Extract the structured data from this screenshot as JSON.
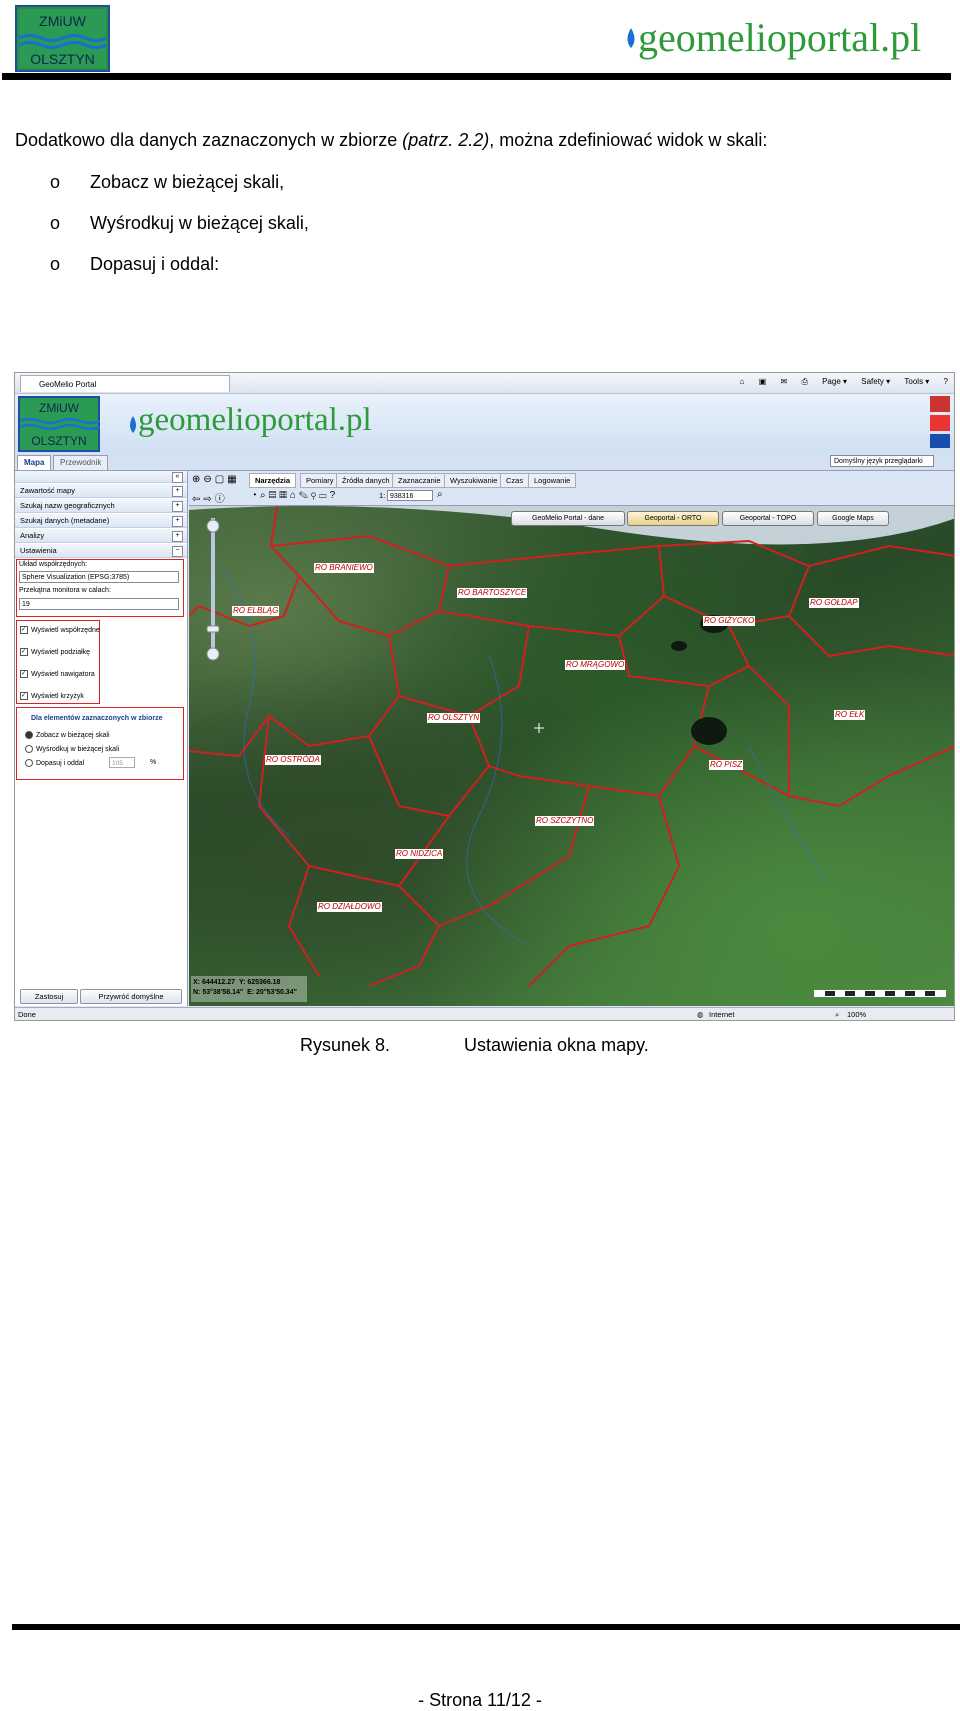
{
  "header": {
    "logo_line1": "ZMiUW",
    "logo_line2": "OLSZTYN",
    "brand": "geomelioportal.pl"
  },
  "body": {
    "intro_before": "Dodatkowo dla danych zaznaczonych w zbiorze ",
    "intro_italic": "(patrz. 2.2)",
    "intro_after": ", można zdefiniować widok w skali:",
    "bullet_marker": "o",
    "bullets": [
      "Zobacz w bieżącej skali,",
      "Wyśrodkuj w bieżącej skali,",
      "Dopasuj i oddal:"
    ]
  },
  "screenshot": {
    "browser": {
      "tab_title": "GeoMelio Portal",
      "tools": [
        "Page ▾",
        "Safety ▾",
        "Tools ▾"
      ],
      "status_done": "Done",
      "status_zone": "Internet",
      "status_zoom": "100%"
    },
    "banner": {
      "logo_line1": "ZMiUW",
      "logo_line2": "OLSZTYN",
      "brand": "geomelioportal.pl",
      "language": "Domyślny język przeglądarki"
    },
    "top_tabs": [
      "Mapa",
      "Przewodnik"
    ],
    "left_panel": {
      "sections": [
        "Zawartość mapy",
        "Szukaj nazw geograficznych",
        "Szukaj danych (metadane)",
        "Analizy",
        "Ustawienia"
      ],
      "coord_label": "Układ współrzędnych:",
      "coord_value": "Sphere Visualization (EPSG:3785)",
      "diag_label": "Przekątna monitora w calach:",
      "diag_value": "19",
      "checkboxes": [
        "Wyświetl współrzędne",
        "Wyświetl podziałkę",
        "Wyświetl nawigatora",
        "Wyświetl krzyżyk"
      ],
      "set_title": "Dla elementów zaznaczonych w zbiorze",
      "radios": [
        "Zobacz w bieżącej skali",
        "Wyśrodkuj w bieżącej skali",
        "Dopasuj i oddal"
      ],
      "zoom_value": "105",
      "zoom_unit": "%",
      "apply": "Zastosuj",
      "reset": "Przywróć domyślne"
    },
    "tool_tabs": [
      "Narzędzia",
      "Pomiary",
      "Źródła danych",
      "Zaznaczanie",
      "Wyszukiwanie",
      "Czas",
      "Logowanie"
    ],
    "scale_prefix": "1:",
    "scale_value": "938316",
    "map_buttons": [
      "GeoMelio Portal - dane",
      "Geoportal - ORTO",
      "Geoportal - TOPO",
      "Google Maps"
    ],
    "regions": [
      "RO BRANIEWO",
      "RO BARTOSZYCE",
      "RO ELBLĄG",
      "RO GIŻYCKO",
      "RO GOŁDAP",
      "RO MRĄGOWO",
      "RO OLSZTYN",
      "RO EŁK",
      "RO OSTRÓDA",
      "RO PISZ",
      "RO SZCZYTNO",
      "RO NIDZICA",
      "RO DZIAŁDOWO"
    ],
    "coords": {
      "x": "X: 644412.27",
      "y": "Y: 625366.18",
      "n": "N: 53°38'58.14\"",
      "e": "E: 20°53'50.34\""
    }
  },
  "caption": {
    "label": "Rysunek 8.",
    "text": "Ustawienia okna mapy."
  },
  "footer": {
    "page": "- Strona 11/12 -"
  }
}
